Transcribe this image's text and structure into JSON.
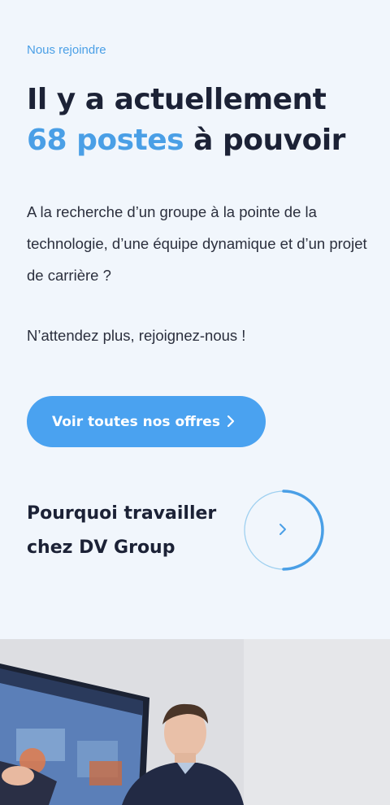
{
  "hero": {
    "eyebrow": "Nous rejoindre",
    "headline_line1": "Il y a actuellement",
    "headline_accent": "68 postes",
    "headline_rest": " à pouvoir",
    "intro": "A la recherche d’un groupe à la pointe de la technologie, d’une équipe dynamique et d’un projet de carrière ?",
    "cta_text": "N’attendez plus, rejoignez-nous !",
    "primary_button_label": "Voir toutes nos offres",
    "primary_button_icon": "chevron-right-icon",
    "why_title_line1": "Pourquoi travailler",
    "why_title_line2": "chez DV Group",
    "circle_button_icon": "chevron-right-icon"
  },
  "colors": {
    "background": "#f1f6fc",
    "accent": "#4a9fe6",
    "button": "#4aa2f0",
    "heading": "#1c2236",
    "body_text": "#2b2f3d"
  },
  "photo": {
    "description_icon": "office-photo"
  }
}
